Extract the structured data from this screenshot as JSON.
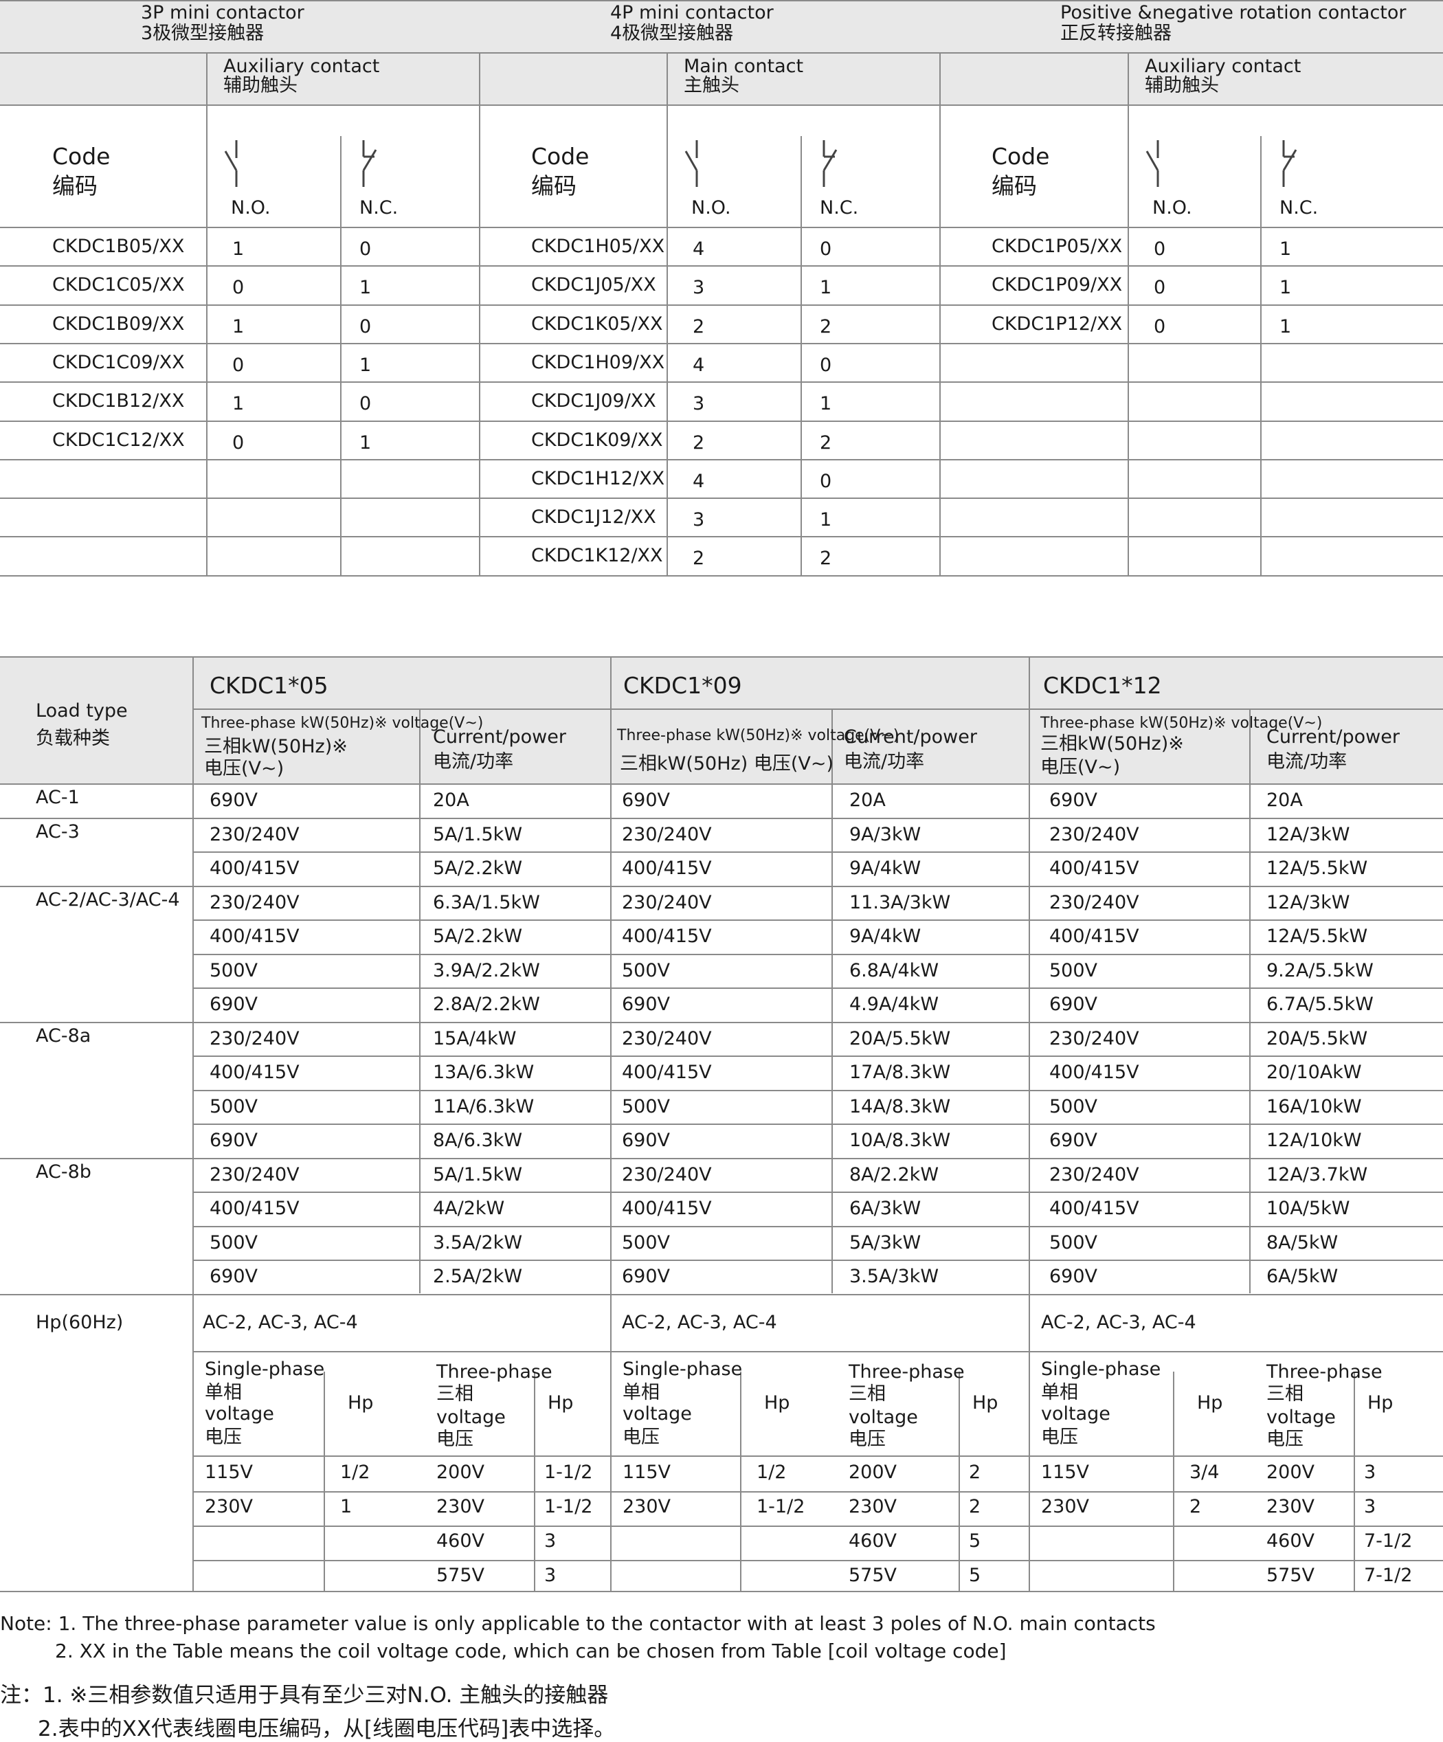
{
  "table1": {
    "groups": [
      {
        "en": "3P mini contactor",
        "cn": "3极微型接触器",
        "contact_en": "Auxiliary contact",
        "contact_cn": "辅助触头"
      },
      {
        "en": "4P mini contactor",
        "cn": "4极微型接触器",
        "contact_en": "Main contact",
        "contact_cn": "主触头"
      },
      {
        "en": "Positive &negative rotation contactor",
        "cn": "正反转接触器",
        "contact_en": "Auxiliary contact",
        "contact_cn": "辅助触头"
      }
    ],
    "code_en": "Code",
    "code_cn": "编码",
    "no": "N.O.",
    "nc": "N.C.",
    "g1_rows": [
      [
        "CKDC1B05/XX",
        "1",
        "0"
      ],
      [
        "CKDC1C05/XX",
        "0",
        "1"
      ],
      [
        "CKDC1B09/XX",
        "1",
        "0"
      ],
      [
        "CKDC1C09/XX",
        "0",
        "1"
      ],
      [
        "CKDC1B12/XX",
        "1",
        "0"
      ],
      [
        "CKDC1C12/XX",
        "0",
        "1"
      ]
    ],
    "g2_rows": [
      [
        "CKDC1H05/XX",
        "4",
        "0"
      ],
      [
        "CKDC1J05/XX",
        "3",
        "1"
      ],
      [
        "CKDC1K05/XX",
        "2",
        "2"
      ],
      [
        "CKDC1H09/XX",
        "4",
        "0"
      ],
      [
        "CKDC1J09/XX",
        "3",
        "1"
      ],
      [
        "CKDC1K09/XX",
        "2",
        "2"
      ],
      [
        "CKDC1H12/XX",
        "4",
        "0"
      ],
      [
        "CKDC1J12/XX",
        "3",
        "1"
      ],
      [
        "CKDC1K12/XX",
        "2",
        "2"
      ]
    ],
    "g3_rows": [
      [
        "CKDC1P05/XX",
        "0",
        "1"
      ],
      [
        "CKDC1P09/XX",
        "0",
        "1"
      ],
      [
        "CKDC1P12/XX",
        "0",
        "1"
      ]
    ]
  },
  "table2": {
    "load_en": "Load type",
    "load_cn": "负载种类",
    "models": [
      "CKDC1*05",
      "CKDC1*09",
      "CKDC1*12"
    ],
    "volt_sm": [
      "Three-phase kW(50Hz)※  voltage(V~)",
      "Three-phase kW(50Hz)※  voltage(V~)",
      "Three-phase kW(50Hz)※ voltage(V~)"
    ],
    "volt_cn": [
      "三相kW(50Hz)※",
      "三相kW(50Hz)  电压(V~)",
      "三相kW(50Hz)※"
    ],
    "volt_cn2": [
      "电压(V~)",
      "",
      "电压(V~)"
    ],
    "cur_en": "Current/power",
    "cur_cn": "电流/功率",
    "load_labels": [
      "AC-1",
      "AC-3",
      "AC-2/AC-3/AC-4",
      "AC-8a",
      "AC-8b",
      "Hp(60Hz)"
    ],
    "rows": [
      [
        "690V",
        "20A",
        "690V",
        "20A",
        "690V",
        "20A"
      ],
      [
        "230/240V",
        "5A/1.5kW",
        "230/240V",
        "9A/3kW",
        "230/240V",
        "12A/3kW"
      ],
      [
        "400/415V",
        "5A/2.2kW",
        "400/415V",
        "9A/4kW",
        "400/415V",
        "12A/5.5kW"
      ],
      [
        "230/240V",
        "6.3A/1.5kW",
        "230/240V",
        "11.3A/3kW",
        "230/240V",
        "12A/3kW"
      ],
      [
        "400/415V",
        "5A/2.2kW",
        "400/415V",
        "9A/4kW",
        "400/415V",
        "12A/5.5kW"
      ],
      [
        "500V",
        "3.9A/2.2kW",
        "500V",
        "6.8A/4kW",
        "500V",
        "9.2A/5.5kW"
      ],
      [
        "690V",
        "2.8A/2.2kW",
        "690V",
        "4.9A/4kW",
        "690V",
        "6.7A/5.5kW"
      ],
      [
        "230/240V",
        "15A/4kW",
        "230/240V",
        "20A/5.5kW",
        "230/240V",
        "20A/5.5kW"
      ],
      [
        "400/415V",
        "13A/6.3kW",
        "400/415V",
        "17A/8.3kW",
        "400/415V",
        "20/10AkW"
      ],
      [
        "500V",
        "11A/6.3kW",
        "500V",
        "14A/8.3kW",
        "500V",
        "16A/10kW"
      ],
      [
        "690V",
        "8A/6.3kW",
        "690V",
        "10A/8.3kW",
        "690V",
        "12A/10kW"
      ],
      [
        "230/240V",
        "5A/1.5kW",
        "230/240V",
        "8A/2.2kW",
        "230/240V",
        "12A/3.7kW"
      ],
      [
        "400/415V",
        "4A/2kW",
        "400/415V",
        "6A/3kW",
        "400/415V",
        "10A/5kW"
      ],
      [
        "500V",
        "3.5A/2kW",
        "500V",
        "5A/3kW",
        "500V",
        "8A/5kW"
      ],
      [
        "690V",
        "2.5A/2kW",
        "690V",
        "3.5A/3kW",
        "690V",
        "6A/5kW"
      ]
    ],
    "hp_cat": "AC-2, AC-3, AC-4",
    "single_en": "Single-phase",
    "single_cn": "单相",
    "three_en": "Three-phase",
    "three_cn": "三相",
    "voltage_en": "voltage",
    "voltage_cn": "电压",
    "hp": "Hp",
    "hp_rows": [
      [
        "115V",
        "1/2",
        "200V",
        "1-1/2",
        "115V",
        "1/2",
        "200V",
        "2",
        "115V",
        "3/4",
        "200V",
        "3"
      ],
      [
        "230V",
        "1",
        "230V",
        "1-1/2",
        "230V",
        "1-1/2",
        "230V",
        "2",
        "230V",
        "2",
        "230V",
        "3"
      ],
      [
        "",
        "",
        "460V",
        "3",
        "",
        "",
        "460V",
        "5",
        "",
        "",
        "460V",
        "7-1/2"
      ],
      [
        "",
        "",
        "575V",
        "3",
        "",
        "",
        "575V",
        "5",
        "",
        "",
        "575V",
        "7-1/2"
      ]
    ]
  },
  "notes": [
    "Note: 1. The three-phase parameter value is only applicable to the contactor with at least 3 poles of N.O. main contacts",
    "2. XX in the Table means the coil voltage code, which can be chosen from  Table [coil voltage code]",
    "注：1. ※三相参数值只适用于具有至少三对N.O. 主触头的接触器",
    "2.表中的XX代表线圈电压编码，从[线圈电压代码]表中选择。"
  ]
}
